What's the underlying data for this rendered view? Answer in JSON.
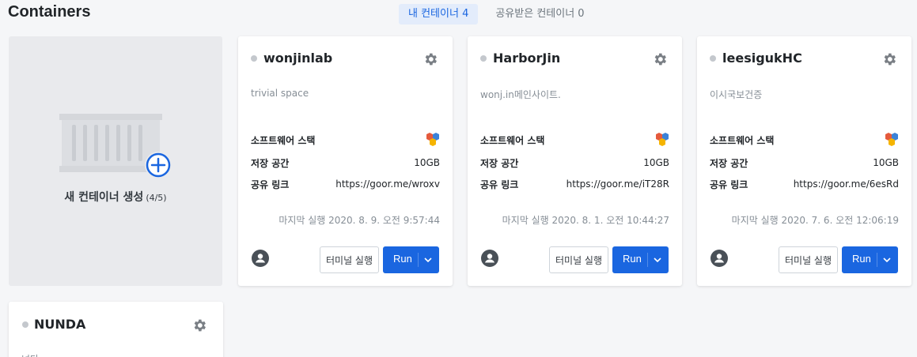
{
  "header": {
    "title": "Containers",
    "tabs": [
      {
        "label": "내 컨테이너 4",
        "active": true
      },
      {
        "label": "공유받은 컨테이너 0",
        "active": false
      }
    ]
  },
  "new_container": {
    "label": "새 컨테이너 생성",
    "count": "(4/5)"
  },
  "labels": {
    "stack": "소프트웨어 스택",
    "storage": "저장 공간",
    "share_link": "공유 링크",
    "terminal": "터미널 실행",
    "run": "Run"
  },
  "containers": [
    {
      "name": "wonjinlab",
      "description": "trivial space",
      "storage": "10GB",
      "share_link": "https://goor.me/wroxv",
      "last_run": "마지막 실행 2020. 8. 9. 오전 9:57:44"
    },
    {
      "name": "HarborJin",
      "description": "wonj.in메인사이트.",
      "storage": "10GB",
      "share_link": "https://goor.me/iT28R",
      "last_run": "마지막 실행 2020. 8. 1. 오전 10:44:27"
    },
    {
      "name": "leesigukHC",
      "description": "이시국보건증",
      "storage": "10GB",
      "share_link": "https://goor.me/6esRd",
      "last_run": "마지막 실행 2020. 7. 6. 오전 12:06:19"
    },
    {
      "name": "NUNDA",
      "description": "넌다"
    }
  ],
  "colors": {
    "accent": "#1a66e0",
    "status_dot": "#c4c8cd",
    "background": "#f5f6f8"
  }
}
